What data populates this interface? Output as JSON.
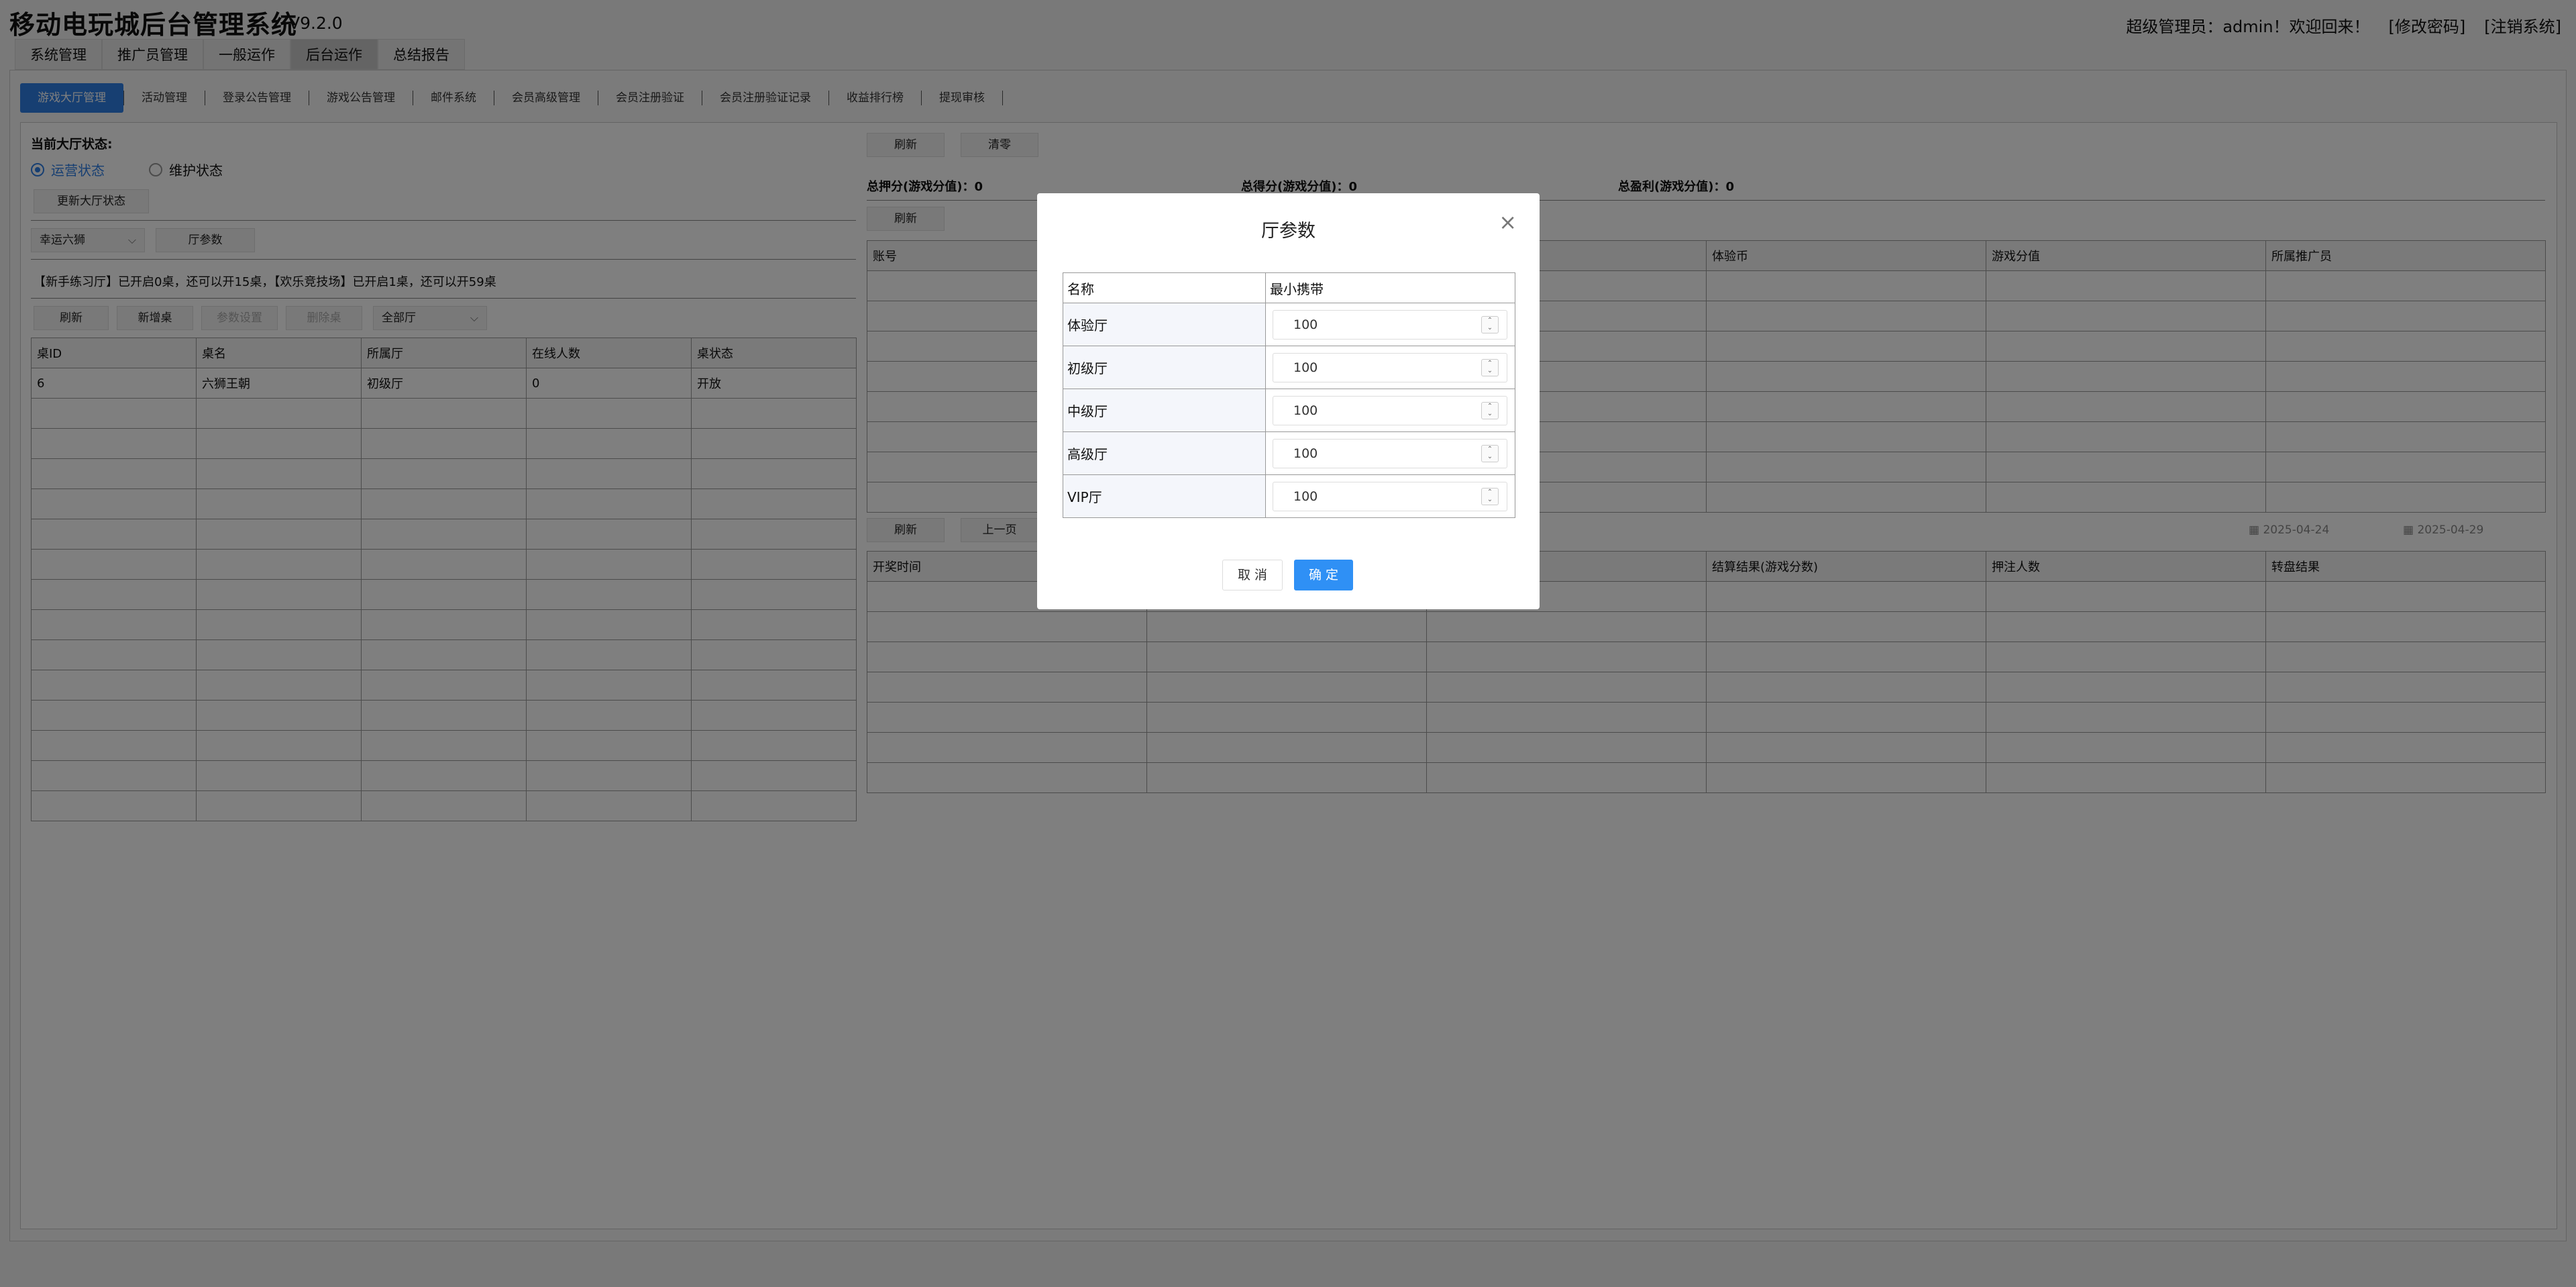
{
  "header": {
    "title": "移动电玩城后台管理系统",
    "version": "V9.2.0",
    "user_text": "超级管理员：admin！欢迎回来！",
    "change_password": "[修改密码]",
    "logout": "[注销系统]"
  },
  "main_tabs": [
    {
      "label": "系统管理"
    },
    {
      "label": "推广员管理"
    },
    {
      "label": "一般运作"
    },
    {
      "label": "后台运作",
      "active": true
    },
    {
      "label": "总结报告"
    }
  ],
  "sub_tabs": [
    {
      "label": "游戏大厅管理",
      "active": true
    },
    {
      "label": "活动管理"
    },
    {
      "label": "登录公告管理"
    },
    {
      "label": "游戏公告管理"
    },
    {
      "label": "邮件系统"
    },
    {
      "label": "会员高级管理"
    },
    {
      "label": "会员注册验证"
    },
    {
      "label": "会员注册验证记录"
    },
    {
      "label": "收益排行榜"
    },
    {
      "label": "提现审核"
    }
  ],
  "left": {
    "status_label": "当前大厅状态:",
    "radio_running": "运营状态",
    "radio_maintain": "维护状态",
    "update_btn": "更新大厅状态",
    "game_select": "幸运六狮",
    "hall_param_btn": "厅参数",
    "notice": "【新手练习厅】已开启0桌，还可以开15桌，【欢乐竞技场】已开启1桌，还可以开59桌",
    "refresh_btn": "刷新",
    "add_table_btn": "新增桌",
    "param_btn": "参数设置",
    "delete_btn": "删除桌",
    "hall_select": "全部厅",
    "table": {
      "headers": [
        "桌ID",
        "桌名",
        "所属厅",
        "在线人数",
        "桌状态"
      ],
      "rows": [
        [
          "6",
          "六狮王朝",
          "初级厅",
          "0",
          "开放"
        ]
      ]
    }
  },
  "right": {
    "refresh_btn": "刷新",
    "clear_btn": "清零",
    "total_bet": "总押分(游戏分值)：0",
    "total_win": "总得分(游戏分值)：0",
    "total_profit": "总盈利(游戏分值)：0",
    "refresh_btn2": "刷新",
    "table1_headers": [
      "账号",
      "",
      "",
      "体验币",
      "游戏分值",
      "所属推广员"
    ],
    "refresh_btn3": "刷新",
    "prev_btn": "上一页",
    "date_start": "2025-04-24",
    "date_end": "2025-04-29",
    "table2_headers": [
      "开奖时间",
      "",
      "",
      "结算结果(游戏分数)",
      "押注人数",
      "转盘结果"
    ]
  },
  "modal": {
    "title": "厅参数",
    "col_name": "名称",
    "col_min": "最小携带",
    "rows": [
      {
        "name": "体验厅",
        "value": "100"
      },
      {
        "name": "初级厅",
        "value": "100"
      },
      {
        "name": "中级厅",
        "value": "100"
      },
      {
        "name": "高级厅",
        "value": "100"
      },
      {
        "name": "VIP厅",
        "value": "100"
      }
    ],
    "cancel": "取 消",
    "ok": "确 定",
    "close": "×"
  }
}
